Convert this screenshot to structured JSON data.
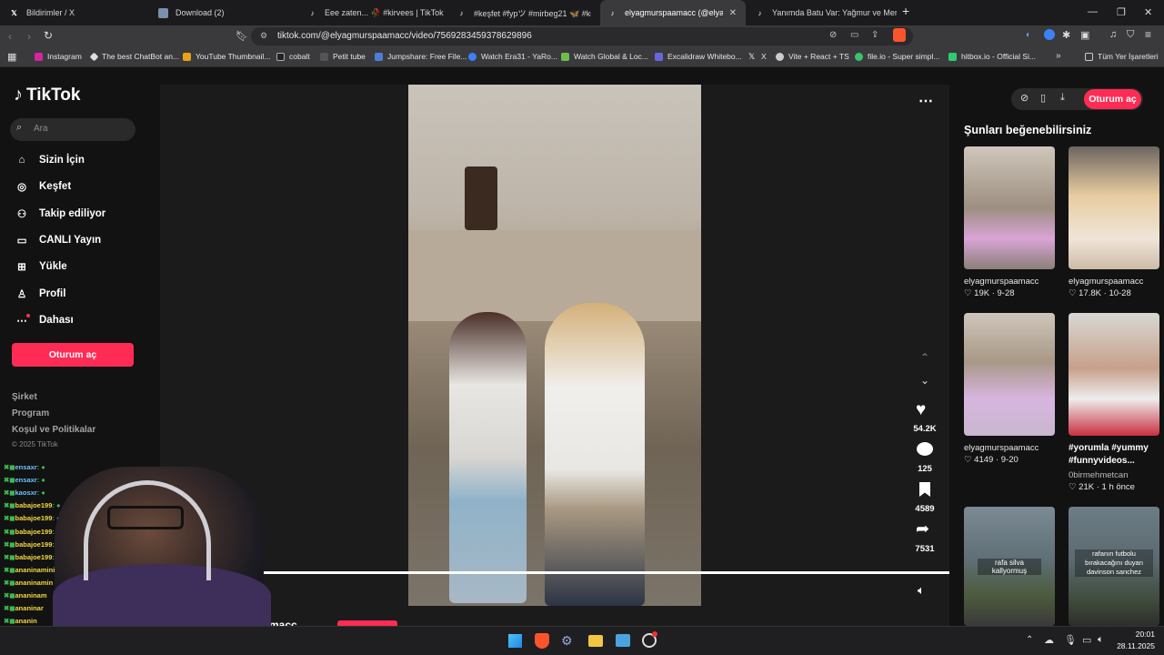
{
  "browser": {
    "tabs": [
      {
        "title": "Bildirimler / X",
        "icon": "x-logo-icon"
      },
      {
        "title": "Download (2)",
        "icon": "download-page-icon"
      },
      {
        "title": "Eee zaten... 🥀 #kirvees | TikTok",
        "icon": "tiktok-icon"
      },
      {
        "title": "#keşfet #fypツ #mirbeg21 🦋 #kurdi",
        "icon": "tiktok-icon"
      },
      {
        "title": "elyagmurspaamacc (@elyagm",
        "icon": "tiktok-icon"
      },
      {
        "title": "Yanımda Batu Var: Yağmur ve Mert ile",
        "icon": "tiktok-icon"
      }
    ],
    "url": "tiktok.com/@elyagmurspaamacc/video/7569283459378629896",
    "bookmarks": [
      "Instagram",
      "The best ChatBot an...",
      "YouTube Thumbnail...",
      "cobalt",
      "Petit tube",
      "Jumpshare: Free File...",
      "Watch Era31 - YaRo...",
      "Watch Global & Loc...",
      "Excalidraw Whitebo...",
      "X",
      "Vite + React + TS",
      "file.io - Super simpl...",
      "hitbox.io - Official Si..."
    ],
    "all_bookmarks": "Tüm Yer İşaretleri"
  },
  "tiktok": {
    "logo": "TikTok",
    "search_placeholder": "Ara",
    "nav": [
      {
        "label": "Sizin İçin",
        "icon": "home-icon"
      },
      {
        "label": "Keşfet",
        "icon": "compass-icon"
      },
      {
        "label": "Takip ediliyor",
        "icon": "following-icon"
      },
      {
        "label": "CANLI Yayın",
        "icon": "live-tv-icon"
      },
      {
        "label": "Yükle",
        "icon": "upload-icon"
      },
      {
        "label": "Profil",
        "icon": "profile-icon"
      },
      {
        "label": "Dahası",
        "icon": "more-icon"
      }
    ],
    "login_button": "Oturum aç",
    "footer_links": [
      "Şirket",
      "Program",
      "Koşul ve Politikalar"
    ],
    "copyright": "© 2025 TikTok",
    "video_actions": {
      "likes": "54.2K",
      "comments": "125",
      "saves": "4589",
      "shares": "7531"
    },
    "username_partial": "macc",
    "top_login": "Oturum aç",
    "suggested_heading": "Şunları beğenebilirsiniz",
    "suggested": [
      {
        "name": "elyagmurspaamacc",
        "likes": "19K",
        "date": "9-28"
      },
      {
        "name": "elyagmurspaamacc",
        "likes": "17.8K",
        "date": "10-28"
      },
      {
        "name": "elyagmurspaamacc",
        "likes": "4149",
        "date": "9-20"
      },
      {
        "name": "0birmehmetcan",
        "title": "#yorumla #yummy #funnyvideos...",
        "likes": "21K",
        "date": "1 h önce"
      },
      {
        "caption": "rafa silva kallyormuş"
      },
      {
        "caption": "rafanın futbolu bırakacağını duyan davinson sanchez"
      }
    ]
  },
  "chat": [
    {
      "user": "ensaxr"
    },
    {
      "user": "ensaxr"
    },
    {
      "user": "kaosxr"
    },
    {
      "user": "babajoe199"
    },
    {
      "user": "babajoe199"
    },
    {
      "user": "babajoe199"
    },
    {
      "user": "babajoe199"
    },
    {
      "user": "babajoe199"
    },
    {
      "user": "ananinaminig"
    },
    {
      "user": "ananinamin"
    },
    {
      "user": "ananinam"
    },
    {
      "user": "ananinar"
    },
    {
      "user": "ananin"
    }
  ],
  "taskbar": {
    "time": "20:01",
    "date": "28.11.2025"
  },
  "colors": {
    "accent": "#fe2c55",
    "page_bg": "#121212"
  }
}
